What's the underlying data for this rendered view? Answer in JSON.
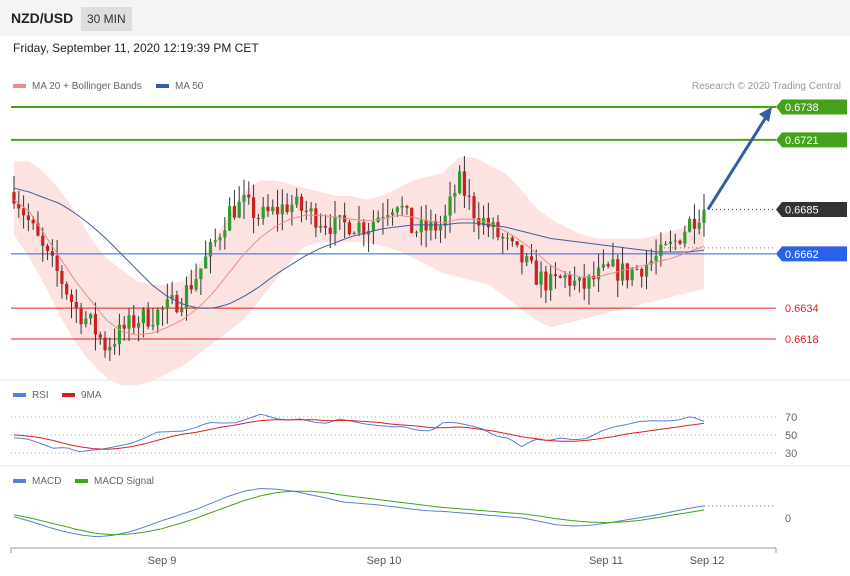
{
  "header": {
    "symbol": "NZD/USD",
    "timeframe": "30 MIN"
  },
  "timestamp": "Friday, September 11, 2020 12:19:39 PM CET",
  "credit": "Research © 2020 Trading Central",
  "legend_main": [
    {
      "label": "MA 20 + Bollinger Bands",
      "color": "#f08a8a"
    },
    {
      "label": "MA 50",
      "color": "#3a5f9e"
    }
  ],
  "legend_rsi": [
    {
      "label": "RSI",
      "color": "#5b7fd4"
    },
    {
      "label": "9MA",
      "color": "#d62020"
    }
  ],
  "legend_macd": [
    {
      "label": "MACD",
      "color": "#5b7fd4"
    },
    {
      "label": "MACD Signal",
      "color": "#44a21a"
    }
  ],
  "chart_data": [
    {
      "type": "candlestick",
      "title": "NZD/USD 30 MIN",
      "x_labels": [
        "Sep 9",
        "Sep 10",
        "Sep 11",
        "Sep 12"
      ],
      "current_price": 0.6685,
      "levels": [
        {
          "value": 0.6738,
          "label": "0.6738",
          "kind": "resistance",
          "color": "#44a21a"
        },
        {
          "value": 0.6721,
          "label": "0.6721",
          "kind": "resistance",
          "color": "#44a21a"
        },
        {
          "value": 0.6685,
          "label": "0.6685",
          "kind": "last",
          "color": "#333333"
        },
        {
          "value": 0.6662,
          "label": "0.6662",
          "kind": "pivot",
          "color": "#2a62e8"
        },
        {
          "value": 0.6634,
          "label": "0.6634",
          "kind": "support",
          "color": "#e02020"
        },
        {
          "value": 0.6618,
          "label": "0.6618",
          "kind": "support",
          "color": "#e02020"
        }
      ],
      "close_path": [
        0.6694,
        0.6678,
        0.6662,
        0.665,
        0.6634,
        0.6626,
        0.6614,
        0.6622,
        0.6628,
        0.663,
        0.6634,
        0.664,
        0.6652,
        0.6666,
        0.6684,
        0.6688,
        0.6681,
        0.6684,
        0.6688,
        0.6684,
        0.668,
        0.6676,
        0.6678,
        0.6676,
        0.6684,
        0.669,
        0.6674,
        0.6675,
        0.6677,
        0.67,
        0.6684,
        0.6676,
        0.6668,
        0.666,
        0.6651,
        0.6646,
        0.665,
        0.6644,
        0.665,
        0.6654,
        0.6652,
        0.6656,
        0.666,
        0.6667,
        0.6678,
        0.6686
      ],
      "ma20_path": [
        0.669,
        0.6684,
        0.6672,
        0.666,
        0.6648,
        0.6638,
        0.6628,
        0.6622,
        0.662,
        0.6621,
        0.6624,
        0.6628,
        0.6634,
        0.6642,
        0.6652,
        0.6662,
        0.667,
        0.6676,
        0.668,
        0.6682,
        0.6682,
        0.6681,
        0.668,
        0.6679,
        0.668,
        0.6682,
        0.6681,
        0.6679,
        0.6678,
        0.668,
        0.668,
        0.6678,
        0.6674,
        0.6669,
        0.6663,
        0.6656,
        0.6652,
        0.665,
        0.665,
        0.6652,
        0.6654,
        0.6656,
        0.6658,
        0.666,
        0.6663,
        0.6666
      ],
      "bb_upper": [
        0.671,
        0.671,
        0.6704,
        0.6695,
        0.6684,
        0.667,
        0.666,
        0.6654,
        0.6648,
        0.6646,
        0.6646,
        0.6648,
        0.6656,
        0.6668,
        0.6682,
        0.6694,
        0.67,
        0.67,
        0.6698,
        0.6696,
        0.6694,
        0.6692,
        0.6692,
        0.669,
        0.6692,
        0.6696,
        0.67,
        0.6702,
        0.6704,
        0.6712,
        0.6712,
        0.6708,
        0.6704,
        0.6696,
        0.6686,
        0.668,
        0.6676,
        0.6672,
        0.667,
        0.667,
        0.667,
        0.667,
        0.6672,
        0.6674,
        0.6677,
        0.6682
      ],
      "bb_lower": [
        0.6672,
        0.666,
        0.6646,
        0.663,
        0.6616,
        0.6606,
        0.6598,
        0.6594,
        0.6594,
        0.6596,
        0.66,
        0.6604,
        0.661,
        0.6616,
        0.6622,
        0.6628,
        0.6638,
        0.6648,
        0.6658,
        0.6666,
        0.6668,
        0.6668,
        0.6668,
        0.6668,
        0.6666,
        0.6664,
        0.666,
        0.6656,
        0.6652,
        0.665,
        0.6648,
        0.6646,
        0.664,
        0.6634,
        0.6628,
        0.6624,
        0.6626,
        0.6628,
        0.663,
        0.6632,
        0.6634,
        0.6636,
        0.6638,
        0.664,
        0.6642,
        0.6644
      ],
      "ma50_path": [
        0.6696,
        0.6694,
        0.6691,
        0.6688,
        0.6683,
        0.6677,
        0.667,
        0.6662,
        0.6654,
        0.6646,
        0.664,
        0.6636,
        0.6634,
        0.6634,
        0.6636,
        0.664,
        0.6645,
        0.6651,
        0.6656,
        0.6661,
        0.6665,
        0.6668,
        0.6671,
        0.6673,
        0.6675,
        0.6676,
        0.6677,
        0.6677,
        0.6677,
        0.6678,
        0.6678,
        0.6677,
        0.6676,
        0.6674,
        0.6672,
        0.667,
        0.6669,
        0.6668,
        0.6667,
        0.6666,
        0.6665,
        0.6664,
        0.6663,
        0.6663,
        0.6663,
        0.6664
      ],
      "target_arrow": {
        "from": 0.6685,
        "to": 0.6738
      }
    },
    {
      "type": "line",
      "title": "RSI",
      "y_ticks": [
        70,
        50,
        30
      ],
      "ylim": [
        20,
        80
      ],
      "series": [
        {
          "name": "RSI",
          "values": [
            50,
            46,
            42,
            38,
            34,
            32,
            33,
            35,
            38,
            42,
            48,
            52,
            56,
            55,
            58,
            62,
            64,
            66,
            70,
            72,
            68,
            66,
            68,
            66,
            64,
            66,
            68,
            64,
            60,
            58,
            62,
            56,
            52,
            64,
            66,
            60,
            54,
            50,
            44,
            40,
            44,
            42,
            44,
            46,
            48,
            52,
            56,
            60,
            62,
            64,
            66,
            68,
            70,
            68
          ]
        },
        {
          "name": "9MA",
          "values": [
            50,
            49,
            47,
            44,
            40,
            37,
            35,
            34,
            35,
            37,
            40,
            44,
            48,
            51,
            53,
            56,
            59,
            61,
            64,
            66,
            67,
            67,
            67,
            67,
            66,
            66,
            66,
            65,
            64,
            62,
            61,
            60,
            58,
            58,
            59,
            58,
            56,
            54,
            51,
            48,
            46,
            44,
            43,
            43,
            44,
            46,
            48,
            51,
            53,
            55,
            57,
            59,
            61,
            63
          ]
        }
      ]
    },
    {
      "type": "line",
      "title": "MACD",
      "y_ticks": [
        0
      ],
      "series": [
        {
          "name": "MACD",
          "values": [
            0.2,
            -0.5,
            -1.3,
            -2.0,
            -2.5,
            -2.8,
            -2.6,
            -2.1,
            -1.3,
            -0.4,
            0.4,
            1.2,
            2.2,
            3.2,
            4.0,
            4.4,
            4.3,
            4.0,
            3.5,
            3.0,
            2.4,
            2.2,
            2.0,
            1.7,
            1.4,
            1.1,
            1.0,
            0.8,
            0.6,
            0.4,
            0.2,
            0.0,
            -0.5,
            -1.0,
            -1.2,
            -1.1,
            -0.8,
            -0.4,
            0.0,
            0.4,
            0.9,
            1.4,
            1.8
          ]
        },
        {
          "name": "MACD Signal",
          "values": [
            0.5,
            0.0,
            -0.6,
            -1.2,
            -1.8,
            -2.3,
            -2.5,
            -2.4,
            -2.1,
            -1.6,
            -0.9,
            -0.1,
            0.8,
            1.7,
            2.6,
            3.3,
            3.8,
            4.0,
            4.0,
            3.8,
            3.4,
            3.1,
            2.8,
            2.5,
            2.2,
            1.9,
            1.6,
            1.4,
            1.2,
            1.0,
            0.8,
            0.6,
            0.3,
            -0.1,
            -0.4,
            -0.6,
            -0.7,
            -0.6,
            -0.4,
            0.0,
            0.4,
            0.8,
            1.2
          ]
        }
      ]
    }
  ]
}
